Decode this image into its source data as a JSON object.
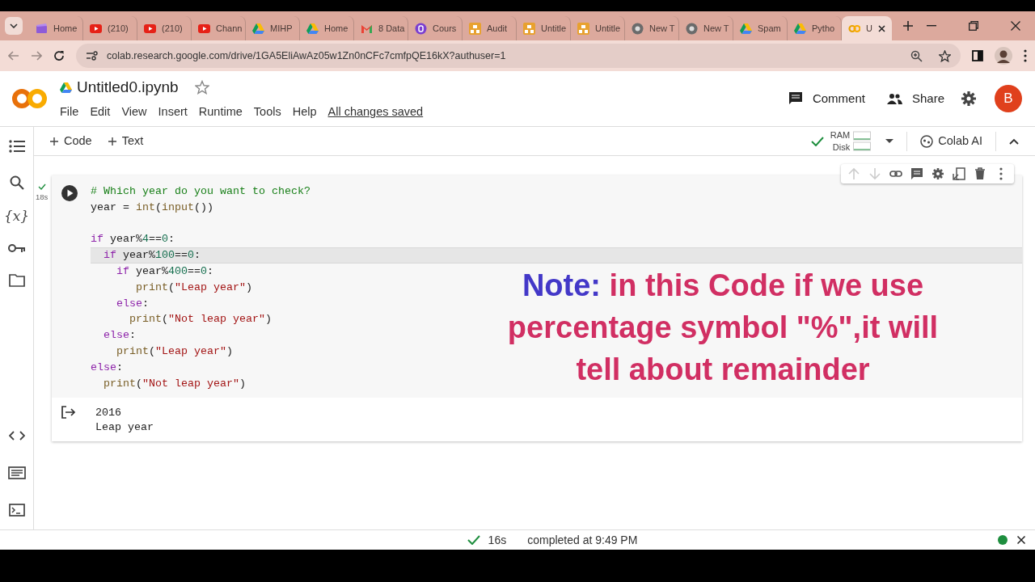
{
  "browser": {
    "tabs": [
      {
        "label": "Home",
        "kind": "clapper",
        "selected": false
      },
      {
        "label": "(210)",
        "kind": "youtube",
        "selected": false
      },
      {
        "label": "(210)",
        "kind": "youtube",
        "selected": false
      },
      {
        "label": "Chann",
        "kind": "youtube",
        "selected": false
      },
      {
        "label": "MIHP",
        "kind": "drive",
        "selected": false
      },
      {
        "label": "Home",
        "kind": "drive",
        "selected": false
      },
      {
        "label": "8 Data",
        "kind": "gmail",
        "selected": false
      },
      {
        "label": "Cours",
        "kind": "course",
        "selected": false
      },
      {
        "label": "Audit",
        "kind": "sheet",
        "selected": false
      },
      {
        "label": "Untitle",
        "kind": "sheet",
        "selected": false
      },
      {
        "label": "Untitle",
        "kind": "sheet",
        "selected": false
      },
      {
        "label": "New T",
        "kind": "chrome",
        "selected": false
      },
      {
        "label": "New T",
        "kind": "chrome",
        "selected": false
      },
      {
        "label": "Spam",
        "kind": "drive",
        "selected": false
      },
      {
        "label": "Pytho",
        "kind": "drive",
        "selected": false
      },
      {
        "label": "U",
        "kind": "colab",
        "selected": true
      }
    ],
    "url": "colab.research.google.com/drive/1GA5EliAwAz05w1Zn0nCFc7cmfpQE16kX?authuser=1"
  },
  "notebook": {
    "title": "Untitled0.ipynb",
    "menu": [
      "File",
      "Edit",
      "View",
      "Insert",
      "Runtime",
      "Tools",
      "Help"
    ],
    "save_status": "All changes saved",
    "comment": "Comment",
    "share": "Share",
    "avatar": "B"
  },
  "toolbar": {
    "add": [
      "Code",
      "Text"
    ],
    "ram": "RAM",
    "disk": "Disk",
    "ai": "Colab AI"
  },
  "sidebar": {
    "variables_glyph": "{x}"
  },
  "cell": {
    "exec_time": "18s",
    "lines": [
      {
        "current": false,
        "tokens": [
          {
            "text": "# Which year do you want to check?",
            "kind": "comment"
          }
        ]
      },
      {
        "current": false,
        "tokens": [
          {
            "text": "year =",
            "kind": "plain"
          },
          {
            "text": " int",
            "kind": "builtin"
          },
          {
            "text": "(",
            "kind": "plain"
          },
          {
            "text": "input",
            "kind": "builtin"
          },
          {
            "text": "())",
            "kind": "plain"
          }
        ]
      },
      {
        "current": false,
        "kind": "blank"
      },
      {
        "current": false,
        "tokens": [
          {
            "text": "if",
            "kind": "keyword"
          },
          {
            "text": " year%",
            "kind": "plain"
          },
          {
            "text": "4",
            "kind": "number"
          },
          {
            "text": "==",
            "kind": "plain"
          },
          {
            "text": "0",
            "kind": "number"
          },
          {
            "text": ":",
            "kind": "plain"
          }
        ]
      },
      {
        "current": true,
        "tokens": [
          {
            "text": "  if",
            "kind": "keyword"
          },
          {
            "text": " year%",
            "kind": "plain"
          },
          {
            "text": "100",
            "kind": "number"
          },
          {
            "text": "==",
            "kind": "plain"
          },
          {
            "text": "0",
            "kind": "number"
          },
          {
            "text": ":",
            "kind": "plain"
          }
        ]
      },
      {
        "current": false,
        "tokens": [
          {
            "text": "    if",
            "kind": "keyword"
          },
          {
            "text": " year%",
            "kind": "plain"
          },
          {
            "text": "400",
            "kind": "number"
          },
          {
            "text": "==",
            "kind": "plain"
          },
          {
            "text": "0",
            "kind": "number"
          },
          {
            "text": ":",
            "kind": "plain"
          }
        ]
      },
      {
        "current": false,
        "tokens": [
          {
            "text": "       print",
            "kind": "builtin"
          },
          {
            "text": "(",
            "kind": "plain"
          },
          {
            "text": "\"Leap year\"",
            "kind": "string"
          },
          {
            "text": ")",
            "kind": "plain"
          }
        ]
      },
      {
        "current": false,
        "tokens": [
          {
            "text": "    else",
            "kind": "keyword"
          },
          {
            "text": ":",
            "kind": "plain"
          }
        ]
      },
      {
        "current": false,
        "tokens": [
          {
            "text": "      print",
            "kind": "builtin"
          },
          {
            "text": "(",
            "kind": "plain"
          },
          {
            "text": "\"Not leap year\"",
            "kind": "string"
          },
          {
            "text": ")",
            "kind": "plain"
          }
        ]
      },
      {
        "current": false,
        "tokens": [
          {
            "text": "  else",
            "kind": "keyword"
          },
          {
            "text": ":",
            "kind": "plain"
          }
        ]
      },
      {
        "current": false,
        "tokens": [
          {
            "text": "    print",
            "kind": "builtin"
          },
          {
            "text": "(",
            "kind": "plain"
          },
          {
            "text": "\"Leap year\"",
            "kind": "string"
          },
          {
            "text": ")",
            "kind": "plain"
          }
        ]
      },
      {
        "current": false,
        "tokens": [
          {
            "text": "else",
            "kind": "keyword"
          },
          {
            "text": ":",
            "kind": "plain"
          }
        ]
      },
      {
        "current": false,
        "tokens": [
          {
            "text": "  print",
            "kind": "builtin"
          },
          {
            "text": "(",
            "kind": "plain"
          },
          {
            "text": "\"Not leap year\"",
            "kind": "string"
          },
          {
            "text": ")",
            "kind": "plain"
          }
        ]
      }
    ],
    "output": [
      "2016",
      "Leap year"
    ]
  },
  "note": {
    "label": "Note:",
    "text": "in this Code if we use percentage symbol \"%\",it will tell about remainder"
  },
  "status_bar": {
    "time": "16s",
    "message": "completed at 9:49 PM",
    "connected": true
  }
}
